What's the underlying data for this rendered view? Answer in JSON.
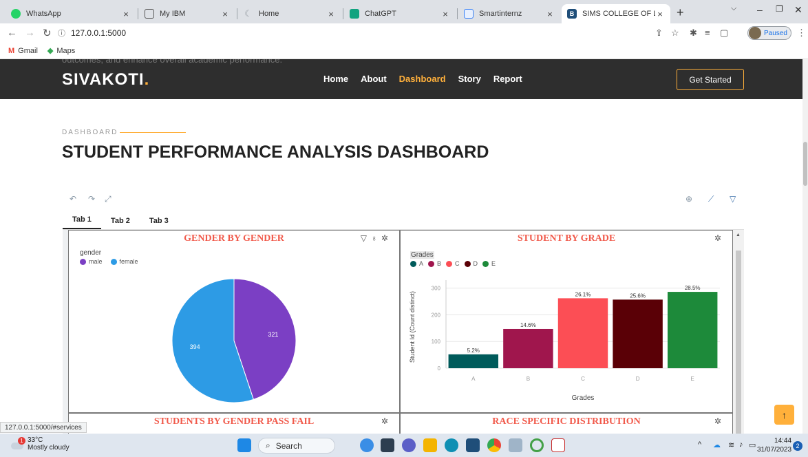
{
  "browser": {
    "tabs": [
      {
        "title": "WhatsApp",
        "color": "#25d366"
      },
      {
        "title": "My IBM",
        "color": "#555555"
      },
      {
        "title": "Home",
        "color": "#9aa0a6"
      },
      {
        "title": "ChatGPT",
        "color": "#10a37f"
      },
      {
        "title": "Smartinternz",
        "color": "#3b82f6"
      },
      {
        "title": "SIMS COLLEGE OF LIFE SCI",
        "color": "#1f4e79",
        "icon_letter": "B"
      }
    ],
    "url": "127.0.0.1:5000",
    "profile_label": "Paused",
    "bookmarks": [
      {
        "label": "Gmail",
        "icon": "gmail-icon",
        "glyph": "M"
      },
      {
        "label": "Maps",
        "icon": "maps-icon",
        "glyph": "◆"
      }
    ],
    "status_url": "127.0.0.1:5000/#services"
  },
  "site": {
    "ghost_text": "outcomes, and enhance overall academic performance.",
    "logo_text": "SIVAKOTI",
    "logo_dot": ".",
    "nav": [
      "Home",
      "About",
      "Dashboard",
      "Story",
      "Report"
    ],
    "active_nav": "Dashboard",
    "cta_label": "Get Started",
    "eyebrow": "DASHBOARD",
    "title": "STUDENT PERFORMANCE ANALYSIS DASHBOARD",
    "accent_color": "#ffb03b"
  },
  "dashboard": {
    "tabs": [
      "Tab 1",
      "Tab 2",
      "Tab 3"
    ],
    "active_tab": "Tab 1",
    "panel_titles": [
      "GENDER BY GENDER",
      "STUDENT BY GRADE",
      "STUDENTS BY GENDER PASS FAIL",
      "RACE SPECIFIC DISTRIBUTION"
    ],
    "title_color": "#f15a4b"
  },
  "chart_data": [
    {
      "type": "pie",
      "title": "GENDER BY GENDER",
      "legend_title": "gender",
      "labels": [
        "male",
        "female"
      ],
      "values": [
        321,
        394
      ],
      "colors": [
        "#7b3fc4",
        "#2d9be5"
      ]
    },
    {
      "type": "bar",
      "title": "STUDENT BY GRADE",
      "legend_title": "Grades",
      "categories": [
        "A",
        "B",
        "C",
        "D",
        "E"
      ],
      "values": [
        52,
        147,
        262,
        257,
        286
      ],
      "data_labels": [
        "5.2%",
        "14.6%",
        "26.1%",
        "25.6%",
        "28.5%"
      ],
      "colors": [
        "#005b5b",
        "#a0164d",
        "#fc4e55",
        "#5a0006",
        "#1d8a3a"
      ],
      "xlabel": "Grades",
      "ylabel": "Student Id (Count distinct)",
      "yticks": [
        0,
        100,
        200,
        300
      ],
      "ylim": [
        0,
        330
      ]
    }
  ],
  "taskbar": {
    "weather_temp": "33°C",
    "weather_desc": "Mostly cloudy",
    "weather_badge": "1",
    "search_label": "Search",
    "time": "14:44",
    "date": "31/07/2023",
    "notif_count": "2"
  }
}
